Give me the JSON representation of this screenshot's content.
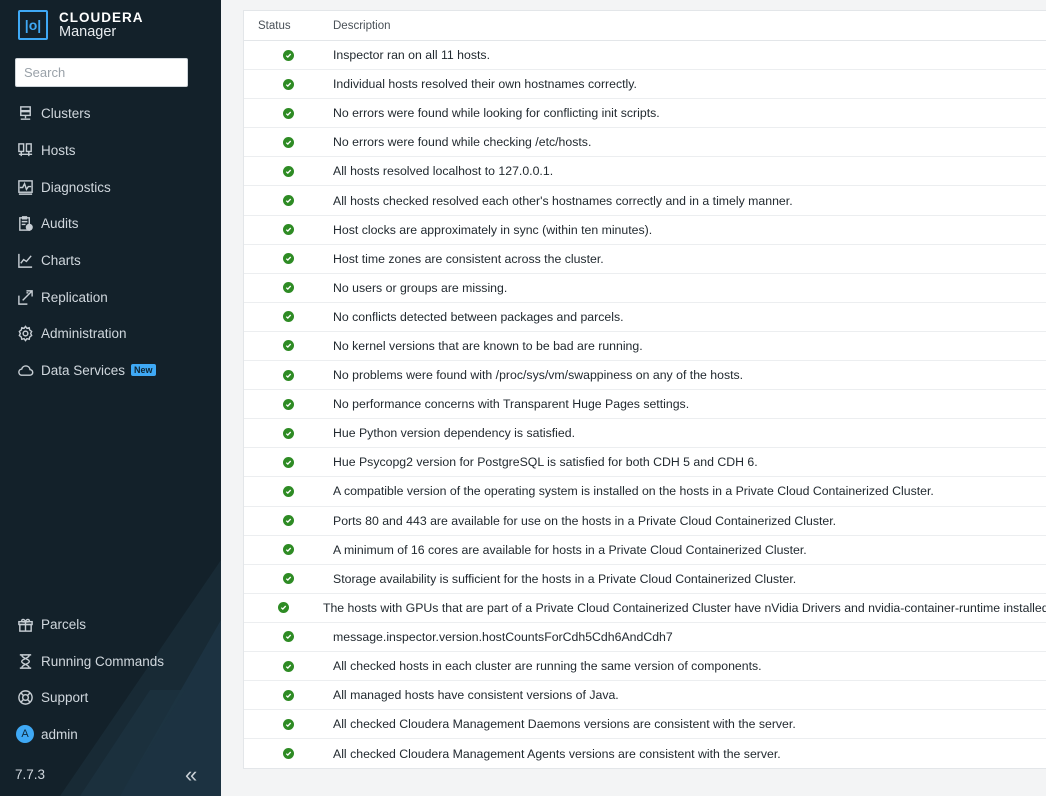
{
  "app": {
    "brand_name": "CLOUDERA",
    "brand_sub": "Manager",
    "logo_glyph": "|o|"
  },
  "search": {
    "placeholder": "Search",
    "value": ""
  },
  "sidebar": {
    "items": [
      {
        "label": "Clusters",
        "icon": "clusters-icon"
      },
      {
        "label": "Hosts",
        "icon": "hosts-icon"
      },
      {
        "label": "Diagnostics",
        "icon": "diagnostics-icon"
      },
      {
        "label": "Audits",
        "icon": "audits-icon"
      },
      {
        "label": "Charts",
        "icon": "charts-icon"
      },
      {
        "label": "Replication",
        "icon": "replication-icon"
      },
      {
        "label": "Administration",
        "icon": "gear-icon"
      },
      {
        "label": "Data Services",
        "icon": "cloud-icon",
        "badge": "New"
      }
    ],
    "bottom_items": [
      {
        "label": "Parcels",
        "icon": "gift-icon"
      },
      {
        "label": "Running Commands",
        "icon": "hourglass-icon"
      },
      {
        "label": "Support",
        "icon": "lifebuoy-icon"
      },
      {
        "label": "admin",
        "icon": "avatar",
        "avatar_letter": "A"
      }
    ],
    "version": "7.7.3",
    "collapse_glyph": "«"
  },
  "colors": {
    "sidebar_bg": "#13212a",
    "accent": "#3fa9f5",
    "status_ok": "#2e8b24"
  },
  "table": {
    "columns": [
      "Status",
      "Description"
    ],
    "rows": [
      {
        "status": "ok",
        "description": "Inspector ran on all 11 hosts."
      },
      {
        "status": "ok",
        "description": "Individual hosts resolved their own hostnames correctly."
      },
      {
        "status": "ok",
        "description": "No errors were found while looking for conflicting init scripts."
      },
      {
        "status": "ok",
        "description": "No errors were found while checking /etc/hosts."
      },
      {
        "status": "ok",
        "description": "All hosts resolved localhost to 127.0.0.1."
      },
      {
        "status": "ok",
        "description": "All hosts checked resolved each other's hostnames correctly and in a timely manner."
      },
      {
        "status": "ok",
        "description": "Host clocks are approximately in sync (within ten minutes)."
      },
      {
        "status": "ok",
        "description": "Host time zones are consistent across the cluster."
      },
      {
        "status": "ok",
        "description": "No users or groups are missing."
      },
      {
        "status": "ok",
        "description": "No conflicts detected between packages and parcels."
      },
      {
        "status": "ok",
        "description": "No kernel versions that are known to be bad are running."
      },
      {
        "status": "ok",
        "description": "No problems were found with /proc/sys/vm/swappiness on any of the hosts."
      },
      {
        "status": "ok",
        "description": "No performance concerns with Transparent Huge Pages settings."
      },
      {
        "status": "ok",
        "description": "Hue Python version dependency is satisfied."
      },
      {
        "status": "ok",
        "description": "Hue Psycopg2 version for PostgreSQL is satisfied for both CDH 5 and CDH 6."
      },
      {
        "status": "ok",
        "description": "A compatible version of the operating system is installed on the hosts in a Private Cloud Containerized Cluster."
      },
      {
        "status": "ok",
        "description": "Ports 80 and 443 are available for use on the hosts in a Private Cloud Containerized Cluster."
      },
      {
        "status": "ok",
        "description": "A minimum of 16 cores are available for hosts in a Private Cloud Containerized Cluster."
      },
      {
        "status": "ok",
        "description": "Storage availability is sufficient for the hosts in a Private Cloud Containerized Cluster."
      },
      {
        "status": "ok",
        "description": "The hosts with GPUs that are part of a Private Cloud Containerized Cluster have nVidia Drivers and nvidia-container-runtime installed."
      },
      {
        "status": "ok",
        "description": "message.inspector.version.hostCountsForCdh5Cdh6AndCdh7"
      },
      {
        "status": "ok",
        "description": "All checked hosts in each cluster are running the same version of components."
      },
      {
        "status": "ok",
        "description": "All managed hosts have consistent versions of Java."
      },
      {
        "status": "ok",
        "description": "All checked Cloudera Management Daemons versions are consistent with the server."
      },
      {
        "status": "ok",
        "description": "All checked Cloudera Management Agents versions are consistent with the server."
      }
    ]
  }
}
